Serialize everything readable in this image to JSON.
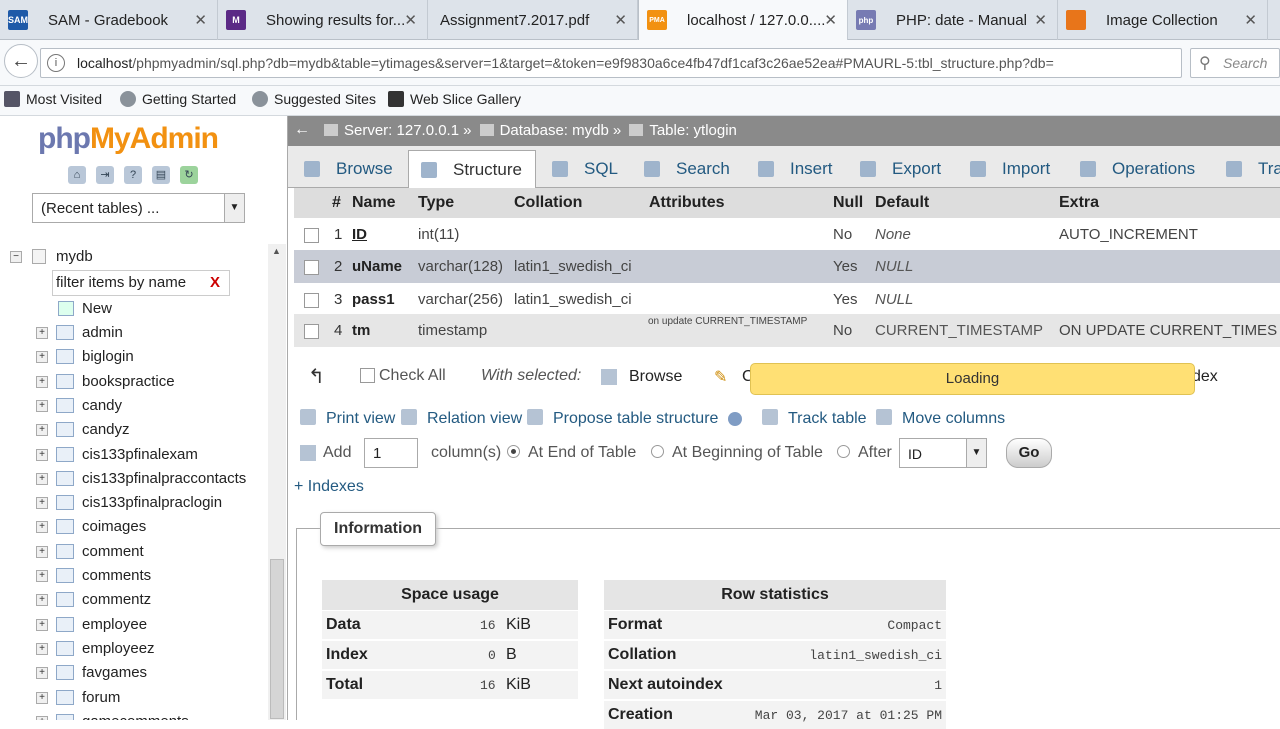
{
  "browser": {
    "tabs": [
      {
        "label": "SAM - Gradebook",
        "favicon": "SAM"
      },
      {
        "label": "Showing results for...",
        "favicon": "M"
      },
      {
        "label": "Assignment7.2017.pdf",
        "favicon": ""
      },
      {
        "label": "localhost / 127.0.0....",
        "favicon": "PMA"
      },
      {
        "label": "PHP: date - Manual",
        "favicon": "php"
      },
      {
        "label": "Image Collection",
        "favicon": ""
      }
    ],
    "url_host": "localhost",
    "url_path": "/phpmyadmin/sql.php?db=mydb&table=ytimages&server=1&target=&token=e9f9830a6ce4fb47df1caf3c26ae52ea#PMAURL-5:tbl_structure.php?db=",
    "search_placeholder": "Search",
    "bookmarks": [
      "Most Visited",
      "Getting Started",
      "Suggested Sites",
      "Web Slice Gallery"
    ]
  },
  "sidebar": {
    "logo_php": "php",
    "logo_myadmin": "MyAdmin",
    "recent_tables": "(Recent tables) ...",
    "db_name": "mydb",
    "filter_placeholder": "filter items by name",
    "filter_clear": "X",
    "new_label": "New",
    "tables": [
      "admin",
      "biglogin",
      "bookspractice",
      "candy",
      "candyz",
      "cis133pfinalexam",
      "cis133pfinalpraccontacts",
      "cis133pfinalpraclogin",
      "coimages",
      "comment",
      "comments",
      "commentz",
      "employee",
      "employeez",
      "favgames",
      "forum",
      "gamecomments"
    ]
  },
  "breadcrumb": {
    "server": "Server: 127.0.0.1",
    "database": "Database: mydb",
    "table": "Table: ytlogin"
  },
  "main_tabs": [
    "Browse",
    "Structure",
    "SQL",
    "Search",
    "Insert",
    "Export",
    "Import",
    "Operations",
    "Tra"
  ],
  "structure": {
    "headers": [
      "#",
      "Name",
      "Type",
      "Collation",
      "Attributes",
      "Null",
      "Default",
      "Extra"
    ],
    "rows": [
      {
        "num": "1",
        "name": "ID",
        "type": "int(11)",
        "collation": "",
        "attributes": "",
        "null": "No",
        "default": "None",
        "extra": "AUTO_INCREMENT"
      },
      {
        "num": "2",
        "name": "uName",
        "type": "varchar(128)",
        "collation": "latin1_swedish_ci",
        "attributes": "",
        "null": "Yes",
        "default": "NULL",
        "extra": ""
      },
      {
        "num": "3",
        "name": "pass1",
        "type": "varchar(256)",
        "collation": "latin1_swedish_ci",
        "attributes": "",
        "null": "Yes",
        "default": "NULL",
        "extra": ""
      },
      {
        "num": "4",
        "name": "tm",
        "type": "timestamp",
        "collation": "",
        "attributes": "on update CURRENT_TIMESTAMP",
        "null": "No",
        "default": "CURRENT_TIMESTAMP",
        "extra": "ON UPDATE CURRENT_TIMES"
      }
    ],
    "check_all": "Check All",
    "with_selected": "With selected:",
    "browse_action": "Browse",
    "change_action_partial": "C",
    "index_action_partial": "dex",
    "loading": "Loading"
  },
  "actions": {
    "print_view": "Print view",
    "relation_view": "Relation view",
    "propose": "Propose table structure",
    "track": "Track table",
    "move": "Move columns",
    "add_label": "Add",
    "add_count": "1",
    "columns_label": "column(s)",
    "at_end": "At End of Table",
    "at_beginning": "At Beginning of Table",
    "after": "After",
    "after_value": "ID",
    "go": "Go",
    "indexes": "+ Indexes"
  },
  "information": {
    "legend": "Information",
    "space_usage": {
      "title": "Space usage",
      "rows": [
        {
          "label": "Data",
          "value": "16",
          "unit": "KiB"
        },
        {
          "label": "Index",
          "value": "0",
          "unit": "B"
        },
        {
          "label": "Total",
          "value": "16",
          "unit": "KiB"
        }
      ]
    },
    "row_statistics": {
      "title": "Row statistics",
      "rows": [
        {
          "label": "Format",
          "value": "Compact"
        },
        {
          "label": "Collation",
          "value": "latin1_swedish_ci"
        },
        {
          "label": "Next autoindex",
          "value": "1"
        },
        {
          "label": "Creation",
          "value": "Mar 03, 2017 at 01:25 PM"
        }
      ]
    }
  },
  "colors": {
    "link": "#235a81",
    "loading": "#ffe074",
    "crumb_bg": "#8a8a8a"
  }
}
